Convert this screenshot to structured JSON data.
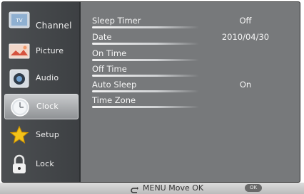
{
  "sidebar": {
    "items": [
      {
        "label": "Channel",
        "icon": "channel-icon"
      },
      {
        "label": "Picture",
        "icon": "picture-icon"
      },
      {
        "label": "Audio",
        "icon": "audio-icon"
      },
      {
        "label": "Clock",
        "icon": "clock-icon"
      },
      {
        "label": "Setup",
        "icon": "setup-icon"
      },
      {
        "label": "Lock",
        "icon": "lock-icon"
      }
    ],
    "selected": "Clock"
  },
  "settings": {
    "sleep_timer": {
      "label": "Sleep Timer",
      "value": "Off"
    },
    "date": {
      "label": "Date",
      "value": "2010/04/30"
    },
    "on_time": {
      "label": "On Time"
    },
    "off_time": {
      "label": "Off Time"
    },
    "auto_sleep": {
      "label": "Auto Sleep",
      "value": "On"
    },
    "time_zone": {
      "label": "Time Zone"
    }
  },
  "hint_bar": {
    "text": "MENU Move OK",
    "ok_badge": "OK"
  },
  "colors": {
    "panel_bg": "#77797b",
    "sidebar_bg": "#46494c",
    "text": "#f5f5f5",
    "hint_bar": "#cccccc"
  }
}
